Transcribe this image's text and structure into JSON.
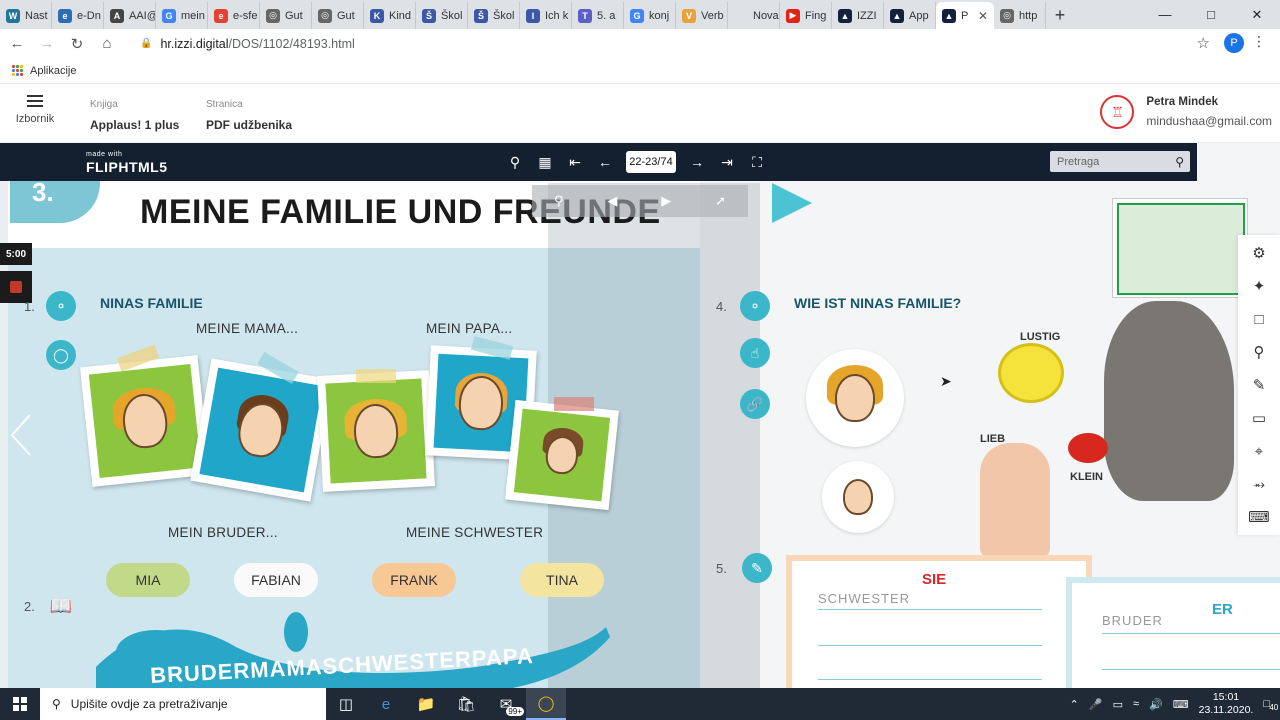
{
  "browser": {
    "tabs": [
      {
        "label": "Nast",
        "color": "#21759b",
        "glyph": "W"
      },
      {
        "label": "e-Dn",
        "color": "#2d6db5",
        "glyph": "e"
      },
      {
        "label": "AAI@",
        "color": "#444",
        "glyph": "A"
      },
      {
        "label": "mein",
        "color": "#4285f4",
        "glyph": "G"
      },
      {
        "label": "e-sfe",
        "color": "#e34133",
        "glyph": "e"
      },
      {
        "label": "Gut",
        "color": "#666",
        "glyph": "◎"
      },
      {
        "label": "Gut",
        "color": "#666",
        "glyph": "◎"
      },
      {
        "label": "Kind",
        "color": "#3b57a6",
        "glyph": "K"
      },
      {
        "label": "Škol",
        "color": "#3b57a6",
        "glyph": "Š"
      },
      {
        "label": "Škol",
        "color": "#3b57a6",
        "glyph": "Š"
      },
      {
        "label": "Ich k",
        "color": "#3b57a6",
        "glyph": "I"
      },
      {
        "label": "5. a",
        "color": "#5b5fc7",
        "glyph": "T"
      },
      {
        "label": "konj",
        "color": "#4285f4",
        "glyph": "G"
      },
      {
        "label": "Verb",
        "color": "#e8a33d",
        "glyph": "V"
      },
      {
        "label": "Nova kar",
        "color": "#dee1e6",
        "glyph": ""
      },
      {
        "label": "Fing",
        "color": "#e62117",
        "glyph": "▶"
      },
      {
        "label": "IZZI",
        "color": "#14213d",
        "glyph": "▲"
      },
      {
        "label": "App",
        "color": "#14213d",
        "glyph": "▲"
      },
      {
        "label": "P",
        "color": "#14213d",
        "glyph": "▲",
        "active": true
      },
      {
        "label": "http",
        "color": "#666",
        "glyph": "◎"
      }
    ],
    "new_tab": "+",
    "url_host": "hr.izzi.digital",
    "url_path": "/DOS/1102/48193.html",
    "profile_initial": "P",
    "bookmarks_label": "Aplikacije"
  },
  "izzi": {
    "menu_label": "Izbornik",
    "book_caption": "Knjiga",
    "book_title": "Applaus! 1 plus",
    "page_caption": "Stranica",
    "page_title": "PDF udžbenika",
    "user_name": "Petra Mindek",
    "user_email": "mindushaa@gmail.com"
  },
  "flipbook": {
    "logo_small": "made with",
    "logo_big": "FLIPHTML5",
    "page_indicator": "22-23/74",
    "search_placeholder": "Pretraga",
    "timer": "5:00"
  },
  "page": {
    "chapter": "3.",
    "title": "MEINE FAMILIE UND FREUNDE",
    "s1_num": "1.",
    "s1_title": "NINAS FAMILIE",
    "mama": "MEINE MAMA...",
    "papa": "MEIN PAPA...",
    "bruder": "MEIN BRUDER...",
    "schwester": "MEINE SCHWESTER",
    "names": [
      "MIA",
      "FABIAN",
      "FRANK",
      "TINA"
    ],
    "s2_num": "2.",
    "lizard_text": "BRUDERMAMASCHWESTERPAPA",
    "s4_num": "4.",
    "s4_title": "WIE IST NINAS FAMILIE?",
    "lustig": "LUSTIG",
    "lieb": "LIEB",
    "klein": "KLEIN",
    "s5_num": "5.",
    "sie": "SIE",
    "schwester_word": "SCHWESTER",
    "er": "ER",
    "bruder_word": "BRUDER"
  },
  "taskbar": {
    "search_placeholder": "Upišite ovdje za pretraživanje",
    "mail_badge": "99+",
    "time": "15:01",
    "date": "23.11.2020.",
    "notifications": "40"
  },
  "colors": {
    "flipbar": "#142030",
    "accent_teal": "#3cb6c9",
    "section_title": "#195569",
    "sie": "#d9262b",
    "er": "#2aa7c6"
  }
}
